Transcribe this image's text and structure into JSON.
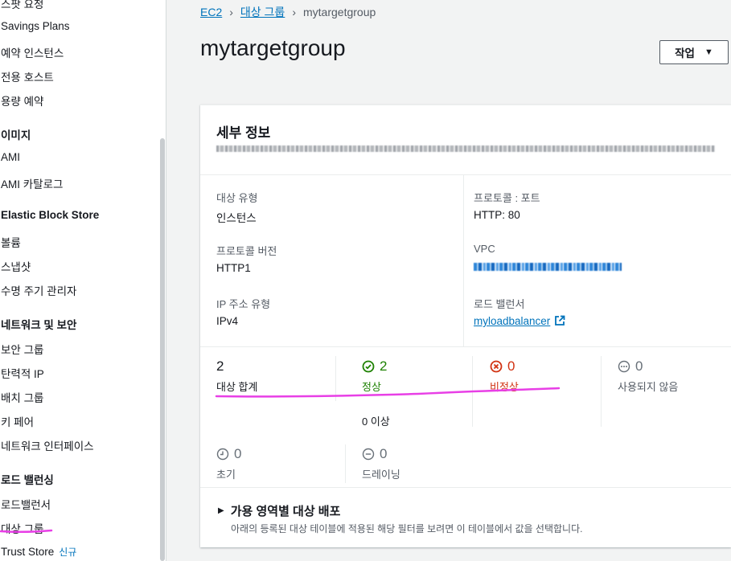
{
  "sidebar": {
    "items": [
      {
        "label": "스팟 요청",
        "type": "item"
      },
      {
        "label": "Savings Plans",
        "type": "item"
      },
      {
        "label": "예약 인스턴스",
        "type": "item"
      },
      {
        "label": "전용 호스트",
        "type": "item"
      },
      {
        "label": "용량 예약",
        "type": "item"
      },
      {
        "label": "이미지",
        "type": "header"
      },
      {
        "label": "AMI",
        "type": "item"
      },
      {
        "label": "AMI 카탈로그",
        "type": "item"
      },
      {
        "label": "Elastic Block Store",
        "type": "header"
      },
      {
        "label": "볼륨",
        "type": "item"
      },
      {
        "label": "스냅샷",
        "type": "item"
      },
      {
        "label": "수명 주기 관리자",
        "type": "item"
      },
      {
        "label": "네트워크 및 보안",
        "type": "header"
      },
      {
        "label": "보안 그룹",
        "type": "item"
      },
      {
        "label": "탄력적 IP",
        "type": "item"
      },
      {
        "label": "배치 그룹",
        "type": "item"
      },
      {
        "label": "키 페어",
        "type": "item"
      },
      {
        "label": "네트워크 인터페이스",
        "type": "item"
      },
      {
        "label": "로드 밸런싱",
        "type": "header"
      },
      {
        "label": "로드밸런서",
        "type": "item"
      },
      {
        "label": "대상 그룹",
        "type": "item",
        "active": true
      },
      {
        "label": "Trust Store",
        "type": "item",
        "badge": "신규"
      }
    ]
  },
  "breadcrumb": {
    "items": [
      "EC2",
      "대상 그룹"
    ],
    "current": "mytargetgroup"
  },
  "page": {
    "title": "mytargetgroup",
    "actions_label": "작업"
  },
  "details": {
    "title": "세부 정보",
    "target_type_label": "대상 유형",
    "target_type_value": "인스턴스",
    "protocol_version_label": "프로토콜 버전",
    "protocol_version_value": "HTTP1",
    "ip_type_label": "IP 주소 유형",
    "ip_type_value": "IPv4",
    "protocol_port_label": "프로토콜 : 포트",
    "protocol_port_value": "HTTP: 80",
    "vpc_label": "VPC",
    "lb_label": "로드 밸런서",
    "lb_value": "myloadbalancer"
  },
  "stats": {
    "total": {
      "count": "2",
      "label": "대상 합계"
    },
    "healthy": {
      "count": "2",
      "label": "정상",
      "sub": "0 이상"
    },
    "unhealthy": {
      "count": "0",
      "label": "비정상"
    },
    "unused": {
      "count": "0",
      "label": "사용되지 않음"
    },
    "initial": {
      "count": "0",
      "label": "초기"
    },
    "draining": {
      "count": "0",
      "label": "드레이닝"
    }
  },
  "az_section": {
    "title": "가용 영역별 대상 배포",
    "description": "아래의 등록된 대상 테이블에 적용된 해당 필터를 보려면 이 테이블에서 값을 선택합니다."
  },
  "colors": {
    "link": "#0073bb",
    "healthy": "#1d8102",
    "unhealthy": "#d13212",
    "muted": "#687078",
    "annotation": "#e83fe6"
  }
}
